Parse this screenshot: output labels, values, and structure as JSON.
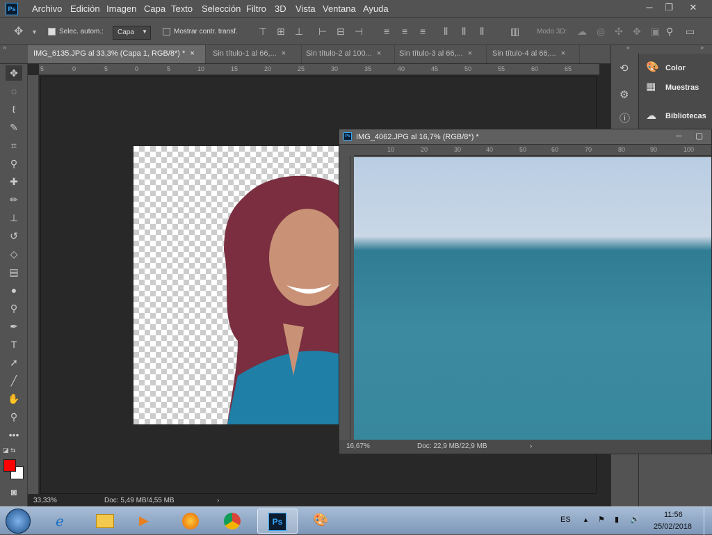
{
  "menubar": {
    "logo": "Ps",
    "items": [
      "Archivo",
      "Edición",
      "Imagen",
      "Capa",
      "Texto",
      "Selección",
      "Filtro",
      "3D",
      "Vista",
      "Ventana",
      "Ayuda"
    ]
  },
  "optionsbar": {
    "auto_select_label": "Selec. autom.:",
    "auto_select_value": "Capa",
    "show_transform_label": "Mostrar contr. transf.",
    "mode3d_label": "Modo 3D:"
  },
  "tabs": [
    {
      "label": "IMG_6135.JPG al 33,3% (Capa 1, RGB/8*) *",
      "close": "×"
    },
    {
      "label": "Sin título-1 al 66,...",
      "close": "×"
    },
    {
      "label": "Sin título-2 al 100...",
      "close": "×"
    },
    {
      "label": "Sin título-3 al 66,...",
      "close": "×"
    },
    {
      "label": "Sin título-4 al 66,...",
      "close": "×"
    }
  ],
  "main_doc": {
    "ruler_ticks": [
      "5",
      "0",
      "5",
      "0",
      "5",
      "10",
      "15",
      "20",
      "25",
      "30",
      "35",
      "40",
      "45",
      "50",
      "55",
      "60",
      "65"
    ],
    "zoom": "33,33%",
    "doc_info": "Doc: 5,49 MB/4,55 MB"
  },
  "float_doc": {
    "title": "IMG_4062.JPG al 16,7% (RGB/8*) *",
    "ruler_ticks": [
      "10",
      "20",
      "30",
      "40",
      "50",
      "60",
      "70",
      "80",
      "90",
      "100"
    ],
    "zoom": "16,67%",
    "doc_info": "Doc: 22,9 MB/22,9 MB"
  },
  "panels": {
    "items": [
      "Color",
      "Muestras",
      "Bibliotecas"
    ]
  },
  "taskbar": {
    "lang": "ES",
    "time": "11:56",
    "date": "25/02/2018",
    "ps_label": "Ps"
  },
  "colors": {
    "foreground": "#ff0000",
    "background": "#ffffff",
    "accent": "#31a8ff"
  }
}
